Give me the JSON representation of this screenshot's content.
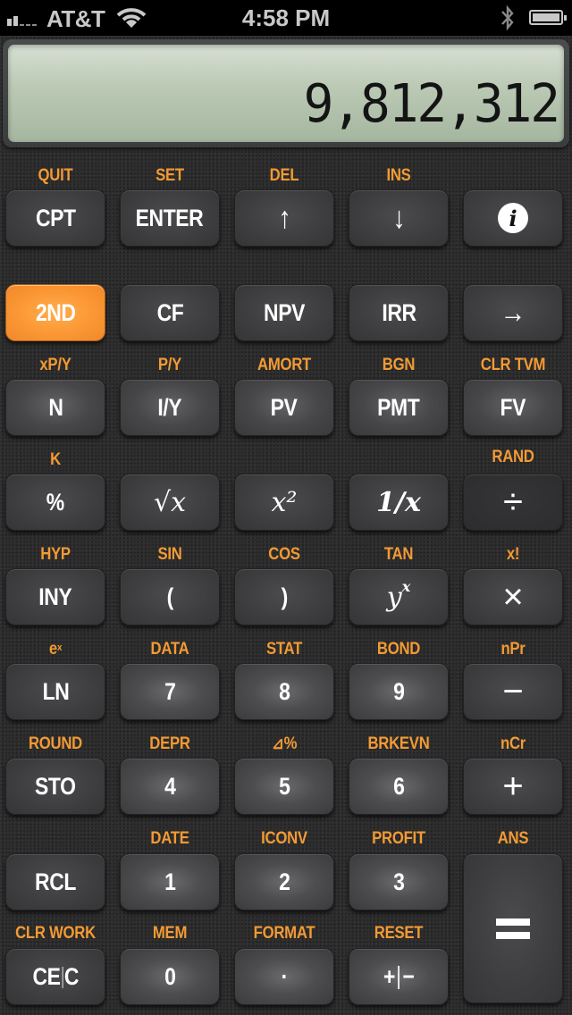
{
  "status_bar": {
    "carrier": "AT&T",
    "time": "4:58 PM",
    "signal_bars_filled": 2,
    "signal_bars_total": 5,
    "icons": [
      "signal-icon",
      "wifi-icon",
      "bluetooth-icon",
      "battery-icon"
    ]
  },
  "display": {
    "value": "9,812,312"
  },
  "colors": {
    "accent_orange": "#f39a34",
    "second_key": "#fb9734",
    "key_gray": "#3d3d3f",
    "lcd_green": "#bccab6"
  },
  "keys": {
    "cpt": {
      "label": "CPT",
      "second": "QUIT"
    },
    "enter": {
      "label": "ENTER",
      "second": "SET"
    },
    "up": {
      "label": "↑",
      "second": "DEL"
    },
    "down": {
      "label": "↓",
      "second": "INS"
    },
    "info": {
      "label": "i",
      "second": ""
    },
    "second": {
      "label": "2ND"
    },
    "cf": {
      "label": "CF"
    },
    "npv": {
      "label": "NPV"
    },
    "irr": {
      "label": "IRR"
    },
    "right": {
      "label": "→"
    },
    "n": {
      "label": "N",
      "second": "xP/Y"
    },
    "iy": {
      "label": "I/Y",
      "second": "P/Y"
    },
    "pv": {
      "label": "PV",
      "second": "AMORT"
    },
    "pmt": {
      "label": "PMT",
      "second": "BGN"
    },
    "fv": {
      "label": "FV",
      "second": "CLR TVM"
    },
    "percent": {
      "label": "%",
      "second": "K"
    },
    "sqrt": {
      "label": "√x",
      "second": ""
    },
    "square": {
      "label": "x²",
      "second": ""
    },
    "reciprocal": {
      "label": "1/x",
      "second": ""
    },
    "divide": {
      "label": "÷",
      "second": "RAND"
    },
    "inv": {
      "label": "INY",
      "second": "HYP"
    },
    "lparen": {
      "label": "(",
      "second": "SIN"
    },
    "rparen": {
      "label": ")",
      "second": "COS"
    },
    "power": {
      "base": "y",
      "exp": "x",
      "second": "TAN"
    },
    "multiply": {
      "label": "×",
      "second": "x!"
    },
    "ln": {
      "label": "LN",
      "second_base": "e",
      "second_exp": "x"
    },
    "seven": {
      "label": "7",
      "second": "DATA"
    },
    "eight": {
      "label": "8",
      "second": "STAT"
    },
    "nine": {
      "label": "9",
      "second": "BOND"
    },
    "minus": {
      "label": "−",
      "second": "nPr"
    },
    "sto": {
      "label": "STO",
      "second": "ROUND"
    },
    "four": {
      "label": "4",
      "second": "DEPR"
    },
    "five": {
      "label": "5",
      "second": "⊿%"
    },
    "six": {
      "label": "6",
      "second": "BRKEVN"
    },
    "plus": {
      "label": "+",
      "second": "nCr"
    },
    "rcl": {
      "label": "RCL",
      "second": ""
    },
    "one": {
      "label": "1",
      "second": "DATE"
    },
    "two": {
      "label": "2",
      "second": "ICONV"
    },
    "three": {
      "label": "3",
      "second": "PROFIT"
    },
    "equals": {
      "label": "=",
      "second": "ANS"
    },
    "cec": {
      "label_left": "CE",
      "label_right": "C",
      "second": "CLR WORK"
    },
    "zero": {
      "label": "0",
      "second": "MEM"
    },
    "decimal": {
      "label": "·",
      "second": "FORMAT"
    },
    "sign": {
      "label_left": "+",
      "label_right": "−",
      "second": "RESET"
    }
  }
}
